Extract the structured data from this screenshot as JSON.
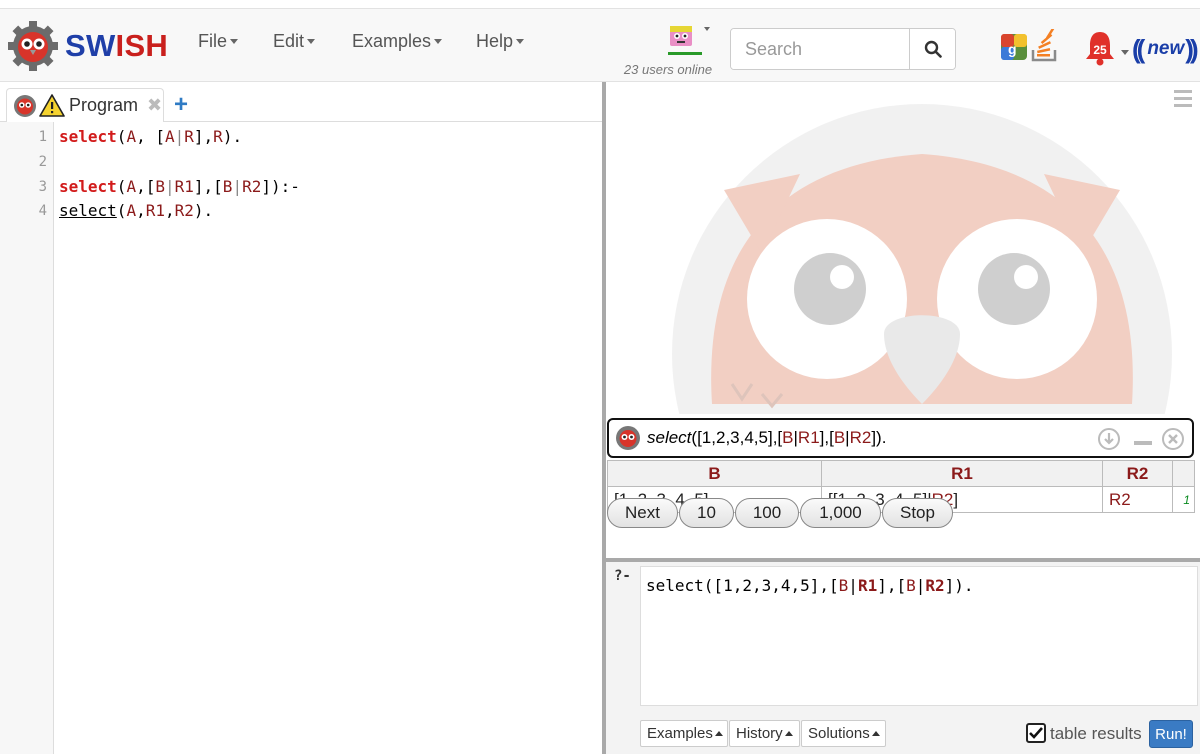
{
  "navbar": {
    "brand": {
      "sw": "SW",
      "is": "ISH"
    },
    "menus": [
      {
        "label": "File"
      },
      {
        "label": "Edit"
      },
      {
        "label": "Examples"
      },
      {
        "label": "Help"
      }
    ],
    "users_online": "23 users online",
    "search": {
      "placeholder": "Search"
    },
    "notification_count": "25",
    "new_badge": "new"
  },
  "left_pane": {
    "tab": {
      "label": "Program",
      "close": "✖",
      "add": "+"
    },
    "line_numbers": [
      "1",
      "2",
      "3",
      "4"
    ],
    "code": [
      [
        {
          "t": "select",
          "c": "kw"
        },
        {
          "t": "(",
          "c": ""
        },
        {
          "t": "A",
          "c": "var"
        },
        {
          "t": ", [",
          "c": ""
        },
        {
          "t": "A",
          "c": "var"
        },
        {
          "t": "|",
          "c": "bar"
        },
        {
          "t": "R",
          "c": "var"
        },
        {
          "t": "],",
          "c": ""
        },
        {
          "t": "R",
          "c": "var"
        },
        {
          "t": ").",
          "c": ""
        }
      ],
      [],
      [
        {
          "t": "select",
          "c": "kw"
        },
        {
          "t": "(",
          "c": ""
        },
        {
          "t": "A",
          "c": "var"
        },
        {
          "t": ",[",
          "c": ""
        },
        {
          "t": "B",
          "c": "var"
        },
        {
          "t": "|",
          "c": "bar"
        },
        {
          "t": "R1",
          "c": "var"
        },
        {
          "t": "],[",
          "c": ""
        },
        {
          "t": "B",
          "c": "var"
        },
        {
          "t": "|",
          "c": "bar"
        },
        {
          "t": "R2",
          "c": "var"
        },
        {
          "t": "]):-",
          "c": ""
        }
      ],
      [
        {
          "t": "select",
          "c": "call"
        },
        {
          "t": "(",
          "c": ""
        },
        {
          "t": "A",
          "c": "var"
        },
        {
          "t": ",",
          "c": ""
        },
        {
          "t": "R1",
          "c": "var"
        },
        {
          "t": ",",
          "c": ""
        },
        {
          "t": "R2",
          "c": "var"
        },
        {
          "t": ").",
          "c": ""
        }
      ]
    ]
  },
  "answer": {
    "query": [
      {
        "t": "select",
        "c": "it"
      },
      {
        "t": "([1,2,3,4,5],[",
        "c": ""
      },
      {
        "t": "B",
        "c": "v"
      },
      {
        "t": "|",
        "c": ""
      },
      {
        "t": "R1",
        "c": "v"
      },
      {
        "t": "],[",
        "c": ""
      },
      {
        "t": "B",
        "c": "v"
      },
      {
        "t": "|",
        "c": ""
      },
      {
        "t": "R2",
        "c": "v"
      },
      {
        "t": "]).",
        "c": ""
      }
    ],
    "columns": [
      "B",
      "R1",
      "R2"
    ],
    "row": {
      "b": "[1, 2, 3, 4, 5]",
      "r1_pre": "[[1, 2, 3, 4, 5]|",
      "r1_var": "R2",
      "r1_post": "]",
      "r2": "R2",
      "count": "1"
    },
    "buttons": [
      "Next",
      "10",
      "100",
      "1,000",
      "Stop"
    ]
  },
  "query_pane": {
    "prompt": "?-",
    "query": [
      {
        "t": "select([1,2,3,4,5],[",
        "c": ""
      },
      {
        "t": "B",
        "c": "v"
      },
      {
        "t": "|",
        "c": ""
      },
      {
        "t": "R1",
        "c": "vb"
      },
      {
        "t": "],[",
        "c": ""
      },
      {
        "t": "B",
        "c": "v"
      },
      {
        "t": "|",
        "c": ""
      },
      {
        "t": "R2",
        "c": "vb"
      },
      {
        "t": "]).",
        "c": ""
      }
    ],
    "examples_label": "Examples",
    "history_label": "History",
    "solutions_label": "Solutions",
    "table_results_label": "table results",
    "table_results_checked": true,
    "run_label": "Run!"
  }
}
